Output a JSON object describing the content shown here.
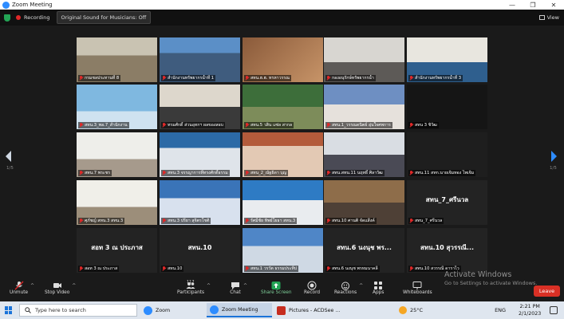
{
  "window": {
    "title": "Zoom Meeting",
    "controls": [
      "—",
      "❐",
      "✕"
    ]
  },
  "topbar": {
    "recording_label": "Recording",
    "original_sound_label": "Original Sound for Musicians: Off",
    "view_label": "View"
  },
  "pagination": {
    "left": "1/5",
    "right": "1/5"
  },
  "tiles": [
    {
      "label": "กรมชลประทานที่ 8",
      "big": ""
    },
    {
      "label": "สำนักงานทรัพยากรน้ำที่ 1",
      "big": ""
    },
    {
      "label": "สทน.ฮ.ฮ. ทรหาวรรณ",
      "big": ""
    },
    {
      "label": "กองอนุรักษ์ทรัพยากรน้ำ",
      "big": ""
    },
    {
      "label": "สำนักงานทรัพยากรน้ำที่ 3",
      "big": ""
    },
    {
      "label": "สทน.3_พอ.7_สำนักงาน",
      "big": ""
    },
    {
      "label": "ทรมศักดิ์ ส่วนอุทกฯ ผลของสอบ",
      "big": ""
    },
    {
      "label": "สทน.5 วสิน แซ่ล สากล",
      "big": ""
    },
    {
      "label": "สทน.1_วรรณดนิตย์ อุ่นใจศพการ",
      "big": ""
    },
    {
      "label": "สทน 3 ชิวัฒ",
      "big": ""
    },
    {
      "label": "สทน.7 พระชร",
      "big": ""
    },
    {
      "label": "สทน.3 จรรญาการที่ทรงศักดิ์ธรรม",
      "big": ""
    },
    {
      "label": "สทน_2_ณัฐธิดา บุญ",
      "big": ""
    },
    {
      "label": "สทน.สทน.11 นฤทธิ์ ศิลาวัฒ",
      "big": ""
    },
    {
      "label": "สทน.11 สทก.นายเจิมทอง ไพเจิม",
      "big": ""
    },
    {
      "label": "ศุภัชญ์ สทน.3 สทน.3",
      "big": ""
    },
    {
      "label": "สทน.3 ปรียา สุจิตรโชติ",
      "big": ""
    },
    {
      "label": "รัศมีชัย ทิพย์โยธา สทน.3",
      "big": ""
    },
    {
      "label": "สทน.10 ศานติ จัดแสีงค์",
      "big": ""
    },
    {
      "label": "สทน_7_ศรีนวล",
      "big": "สทน_7_ศรีนวล"
    },
    {
      "label": "สอท 3 ณ ประภาส",
      "big": "สอท 3 ณ ประภาส"
    },
    {
      "label": "สทน.10",
      "big": "สทน.10"
    },
    {
      "label": "สทน.1 วรวัต ธรรมประทีป",
      "big": ""
    },
    {
      "label": "สทน.6 นงนุช พรหมนาคลี",
      "big": "สทน.6 นงนุช พร..."
    },
    {
      "label": "สทน.10 สวรรณี ดาราไว",
      "big": "สทน.10 สุวรรณี..."
    }
  ],
  "toolbar": {
    "unmute": "Unmute",
    "stop_video": "Stop Video",
    "participants": "Participants",
    "participant_count": "117",
    "chat": "Chat",
    "share_screen": "Share Screen",
    "record": "Record",
    "reactions": "Reactions",
    "apps": "Apps",
    "whiteboards": "Whiteboards",
    "leave": "Leave"
  },
  "watermark": {
    "title": "Activate Windows",
    "subtitle": "Go to Settings to activate Windows."
  },
  "taskbar": {
    "search_placeholder": "Type here to search",
    "apps": [
      "Zoom",
      "Zoom Meeting",
      "Pictures - ACDSee ..."
    ],
    "temperature": "25°C",
    "language": "ENG",
    "time": "2:21 PM",
    "date": "2/1/2023"
  },
  "colors": {
    "accent": "#2d8cff",
    "leave": "#d93025",
    "active_speaker": "#f2e21a",
    "muted": "#e02828"
  }
}
